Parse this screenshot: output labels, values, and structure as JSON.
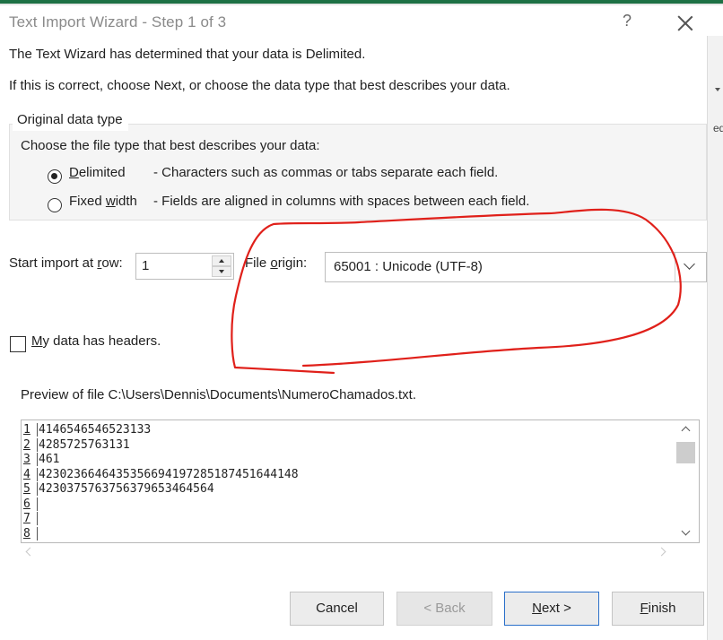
{
  "window": {
    "title": "Text Import Wizard - Step 1 of 3",
    "help_icon": "?",
    "close_icon": "close-icon"
  },
  "intro": {
    "line1": "The Text Wizard has determined that your data is Delimited.",
    "line2": "If this is correct, choose Next, or choose the data type that best describes your data."
  },
  "original_type": {
    "legend": "Original data type",
    "prompt": "Choose the file type that best describes your data:",
    "options": [
      {
        "label_prefix": "",
        "label_accel": "D",
        "label_suffix": "elimited",
        "description": "- Characters such as commas or tabs separate each field.",
        "selected": true
      },
      {
        "label_prefix": "Fixed ",
        "label_accel": "w",
        "label_suffix": "idth",
        "description": "- Fields are aligned in columns with spaces between each field.",
        "selected": false
      }
    ]
  },
  "start_import": {
    "label_prefix": "Start import at ",
    "label_accel": "r",
    "label_suffix": "ow:",
    "value": "1"
  },
  "file_origin": {
    "label_prefix": "File ",
    "label_accel": "o",
    "label_suffix": "rigin:",
    "value": "65001 : Unicode (UTF-8)"
  },
  "headers_checkbox": {
    "label_accel": "M",
    "label_suffix": "y data has headers.",
    "checked": false
  },
  "preview": {
    "label": "Preview of file C:\\Users\\Dennis\\Documents\\NumeroChamados.txt.",
    "rows": [
      {
        "num": "1",
        "text": "4146546546523133"
      },
      {
        "num": "2",
        "text": "4285725763131"
      },
      {
        "num": "3",
        "text": "461"
      },
      {
        "num": "4",
        "text": "4230236646435356694197285187451644148"
      },
      {
        "num": "5",
        "text": "4230375763756379653464564"
      },
      {
        "num": "6",
        "text": ""
      },
      {
        "num": "7",
        "text": ""
      },
      {
        "num": "8",
        "text": ""
      }
    ]
  },
  "buttons": {
    "cancel": "Cancel",
    "back": "< Back",
    "next_accel": "N",
    "next_suffix": "ext >",
    "finish_accel": "F",
    "finish_suffix": "inish"
  },
  "colors": {
    "title_text": "#8a8a8a",
    "excel_green": "#1e7145",
    "focus_border": "#2a6fc9",
    "annotation_red": "#e0201a"
  }
}
